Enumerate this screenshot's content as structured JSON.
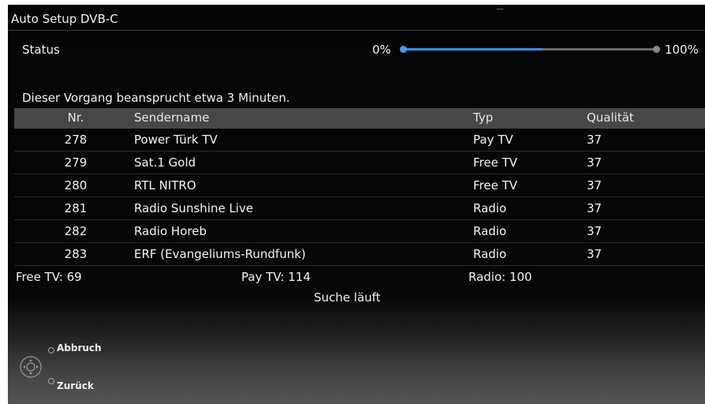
{
  "window": {
    "title": "Auto Setup DVB-C"
  },
  "status": {
    "label": "Status",
    "min_label": "0%",
    "max_label": "100%",
    "progress_fraction": 0.55
  },
  "info_text": "Dieser Vorgang beansprucht etwa 3 Minuten.",
  "table": {
    "headers": {
      "nr": "Nr.",
      "name": "Sendername",
      "typ": "Typ",
      "qualitaet": "Qualität"
    },
    "rows": [
      {
        "nr": "278",
        "name": "Power Türk TV",
        "typ": "Pay TV",
        "qualitaet": "37"
      },
      {
        "nr": "279",
        "name": "Sat.1 Gold",
        "typ": "Free TV",
        "qualitaet": "37"
      },
      {
        "nr": "280",
        "name": "RTL NITRO",
        "typ": "Free TV",
        "qualitaet": "37"
      },
      {
        "nr": "281",
        "name": "Radio Sunshine Live",
        "typ": "Radio",
        "qualitaet": "37"
      },
      {
        "nr": "282",
        "name": "Radio Horeb",
        "typ": "Radio",
        "qualitaet": "37"
      },
      {
        "nr": "283",
        "name": "ERF (Evangeliums-Rundfunk)",
        "typ": "Radio",
        "qualitaet": "37"
      }
    ]
  },
  "summary": {
    "free_tv": "Free TV: 69",
    "pay_tv": "Pay TV: 114",
    "radio": "Radio: 100"
  },
  "search_status": "Suche läuft",
  "controls": {
    "icon": "remote-navigation-icon",
    "abbruch": "Abbruch",
    "zurueck": "Zurück"
  },
  "colors": {
    "progress_fill": "#3f8de0",
    "header_row": "#474747"
  }
}
